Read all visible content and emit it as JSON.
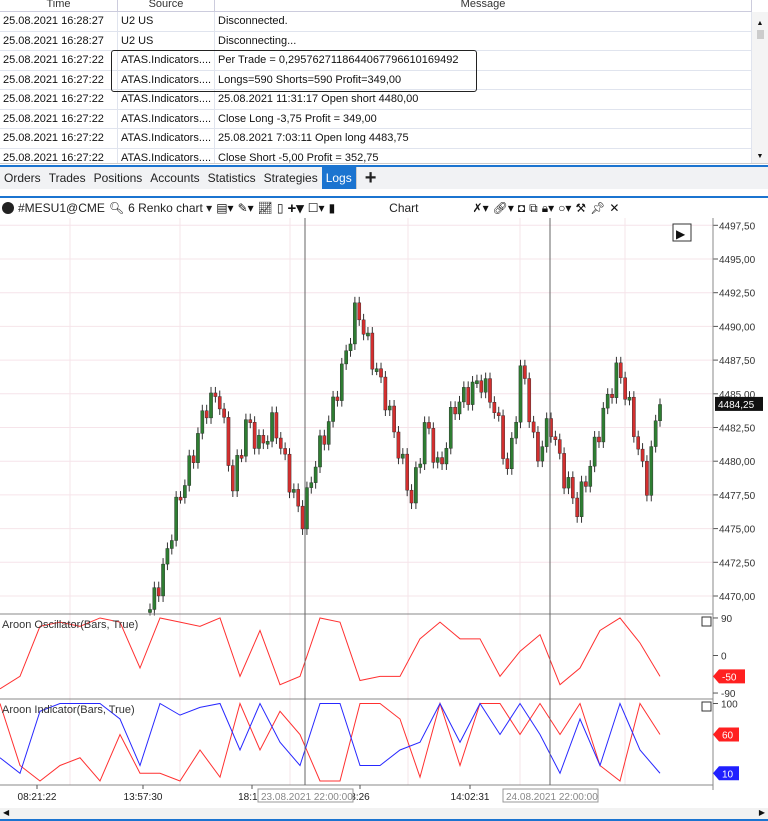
{
  "log_table": {
    "columns": [
      "Time",
      "Source",
      "Message"
    ],
    "rows": [
      [
        "25.08.2021 16:28:27",
        "U2 US",
        "Disconnected."
      ],
      [
        "25.08.2021 16:28:27",
        "U2 US",
        "Disconnecting..."
      ],
      [
        "25.08.2021 16:27:22",
        "ATAS.Indicators....",
        "Per Trade = 0,295762711864406779661016949​2"
      ],
      [
        "25.08.2021 16:27:22",
        "ATAS.Indicators....",
        "Longs=590 Shorts=590 Profit=349,00"
      ],
      [
        "25.08.2021 16:27:22",
        "ATAS.Indicators....",
        "25.08.2021 11:31:17 Open short 4480,00"
      ],
      [
        "25.08.2021 16:27:22",
        "ATAS.Indicators....",
        "Close Long -3,75 Profit = 349,00"
      ],
      [
        "25.08.2021 16:27:22",
        "ATAS.Indicators....",
        "25.08.2021 7:03:11 Open long 4483,75"
      ],
      [
        "25.08.2021 16:27:22",
        "ATAS.Indicators....",
        "Close Short -5,00 Profit = 352,75"
      ]
    ]
  },
  "tabs": [
    "Orders",
    "Trades",
    "Positions",
    "Accounts",
    "Statistics",
    "Strategies",
    "Logs"
  ],
  "active_tab": "Logs",
  "toolbar": {
    "instrument": "#MESU1@CME",
    "chart_type": "6 Renko chart",
    "title": "Chart"
  },
  "colors": {
    "accent": "#1b74d0",
    "up": "#2e7d32",
    "down": "#d32f2f",
    "aroon_up": "#ff3030",
    "aroon_down": "#2828ff"
  },
  "chart_data": [
    {
      "type": "candlestick",
      "ylim": [
        4468.5,
        4497.5
      ],
      "y_ticks": [
        "4497,50",
        "4495,00",
        "4492,50",
        "4490,00",
        "4487,50",
        "4485,00",
        "4482,50",
        "4480,00",
        "4477,50",
        "4475,00",
        "4472,50",
        "4470,00"
      ],
      "last_price": "4484,25",
      "price_path": [
        4469,
        4472,
        4477,
        4480,
        4484,
        4485,
        4478,
        4483,
        4481,
        4483,
        4479,
        4475.5,
        4480,
        4483,
        4487,
        4491.5,
        4488,
        4485,
        4481,
        4477,
        4483,
        4479,
        4484,
        4485,
        4486,
        4484,
        4479,
        4487.5,
        4480,
        4483,
        4479,
        4476.5,
        4480,
        4484,
        4487,
        4483,
        4478,
        4485
      ]
    },
    {
      "type": "line",
      "title": "Aroon Oscillator(Bars, True)",
      "y_ticks": [
        "90",
        "0",
        "-90"
      ],
      "last_value": "-50",
      "ylim": [
        -90,
        90
      ],
      "values": [
        -80,
        -50,
        70,
        80,
        70,
        90,
        80,
        -30,
        90,
        80,
        70,
        90,
        -50,
        60,
        -70,
        -50,
        90,
        80,
        -60,
        -50,
        -50,
        40,
        80,
        40,
        40,
        -50,
        10,
        50,
        -70,
        -30,
        60,
        90,
        30,
        -50
      ]
    },
    {
      "type": "line",
      "title": "Aroon Indicator(Bars, True)",
      "y_ticks": [
        "100"
      ],
      "ylim": [
        0,
        100
      ],
      "series": [
        {
          "last_value": "60",
          "values": [
            100,
            20,
            0,
            20,
            30,
            0,
            60,
            10,
            10,
            0,
            40,
            5,
            100,
            40,
            90,
            60,
            0,
            0,
            100,
            100,
            80,
            5,
            100,
            20,
            100,
            100,
            60,
            100,
            60,
            100,
            20,
            0,
            100,
            60
          ]
        },
        {
          "last_value": "10",
          "values": [
            30,
            10,
            90,
            100,
            100,
            100,
            80,
            20,
            100,
            85,
            95,
            100,
            40,
            100,
            50,
            20,
            100,
            100,
            20,
            20,
            40,
            50,
            100,
            50,
            100,
            60,
            100,
            60,
            10,
            80,
            20,
            100,
            40,
            10
          ]
        }
      ]
    },
    {
      "x_ticks": [
        "08:21:22",
        "13:57:30",
        "18:15:",
        "3:26",
        "14:02:31"
      ],
      "x_markers": [
        "23.08.2021 22:00:00",
        "24.08.2021 22:00:00"
      ]
    }
  ]
}
